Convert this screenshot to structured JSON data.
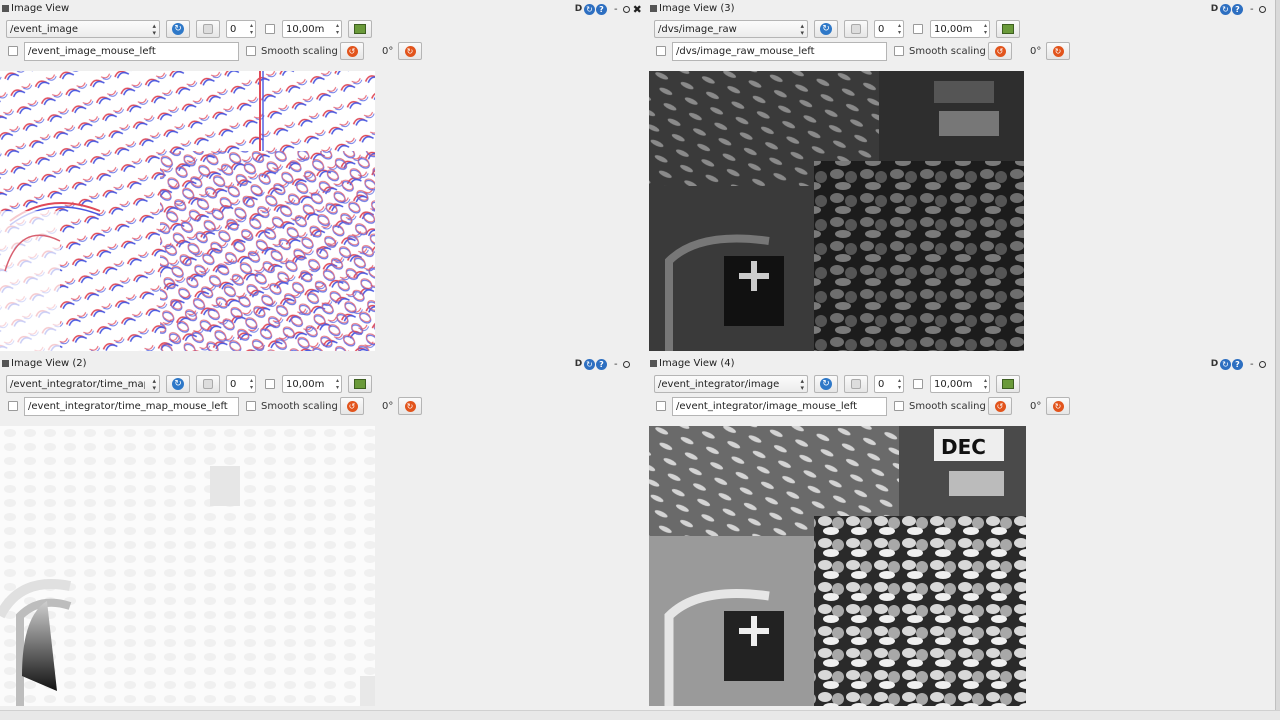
{
  "panels": [
    {
      "title": "Image View",
      "topic": "/event_image",
      "num_value": "0",
      "max_value": "10,00m",
      "mouse_topic": "/event_image_mouse_left",
      "smooth_label": "Smooth scaling",
      "angle": "0°"
    },
    {
      "title": "Image View (2)",
      "topic": "/event_integrator/time_map",
      "num_value": "0",
      "max_value": "10,00m",
      "mouse_topic": "/event_integrator/time_map_mouse_left",
      "smooth_label": "Smooth scaling",
      "angle": "0°"
    },
    {
      "title": "Image View (3)",
      "topic": "/dvs/image_raw",
      "num_value": "0",
      "max_value": "10,00m",
      "mouse_topic": "/dvs/image_raw_mouse_left",
      "smooth_label": "Smooth scaling",
      "angle": "0°"
    },
    {
      "title": "Image View (4)",
      "topic": "/event_integrator/image",
      "num_value": "0",
      "max_value": "10,00m",
      "mouse_topic": "/event_integrator/image_mouse_left",
      "smooth_label": "Smooth scaling",
      "angle": "0°"
    }
  ],
  "titlebar_buttons": {
    "dock_label": "D",
    "minimize_label": "-",
    "close_label": "✖"
  },
  "icons": {
    "reload": "reload-icon",
    "help": "help-icon",
    "refresh": "refresh-icon",
    "save": "save-icon",
    "color": "color-picker-icon",
    "rotate_left": "rotate-left-icon",
    "rotate_right": "rotate-right-icon"
  },
  "colors": {
    "accent_blue": "#2e78c8",
    "rotate_orange": "#e2541c",
    "event_positive": "#e03a4a",
    "event_negative": "#3a4ae0"
  }
}
